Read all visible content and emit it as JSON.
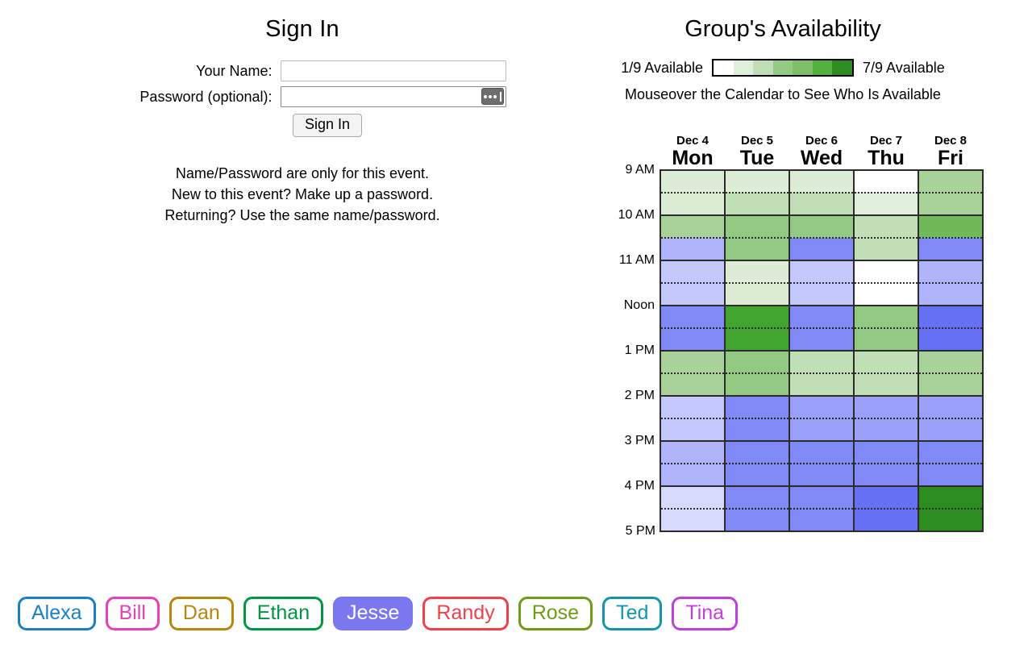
{
  "signin": {
    "title": "Sign In",
    "name_label": "Your Name:",
    "name_value": "",
    "name_placeholder": "",
    "password_label": "Password (optional):",
    "password_value": "",
    "password_placeholder": "",
    "password_manager_icon": "password-manager-icon",
    "button_label": "Sign In",
    "help_lines": [
      "Name/Password are only for this event.",
      "New to this event? Make up a password.",
      "Returning? Use the same name/password."
    ]
  },
  "availability": {
    "title": "Group's Availability",
    "legend_min_label": "1/9 Available",
    "legend_max_label": "7/9 Available",
    "legend_colors": [
      "#ffffff",
      "#e0efdb",
      "#c1dfb6",
      "#93c983",
      "#7ec06a",
      "#52b03f",
      "#2d8c20"
    ],
    "mouseover_hint": "Mouseover the Calendar to See Who Is Available"
  },
  "calendar": {
    "days": [
      {
        "date": "Dec 4",
        "dow": "Mon"
      },
      {
        "date": "Dec 5",
        "dow": "Tue"
      },
      {
        "date": "Dec 6",
        "dow": "Wed"
      },
      {
        "date": "Dec 7",
        "dow": "Thu"
      },
      {
        "date": "Dec 8",
        "dow": "Fri"
      }
    ],
    "time_labels": [
      "9 AM",
      "10 AM",
      "11 AM",
      "Noon",
      "1 PM",
      "2 PM",
      "3 PM",
      "4 PM",
      "5 PM"
    ],
    "slot_times": [
      "9:00",
      "9:30",
      "10:00",
      "10:30",
      "11:00",
      "11:30",
      "12:00",
      "12:30",
      "13:00",
      "13:30",
      "14:00",
      "14:30",
      "15:00",
      "15:30",
      "16:00",
      "16:30"
    ],
    "palette": {
      "green": [
        "#ffffff",
        "#e0efdb",
        "#c1dfb6",
        "#93c983",
        "#7ec06a",
        "#52b03f",
        "#2d8c20"
      ],
      "blue": [
        "#d6dafd",
        "#c3c9fc",
        "#b0b4fa",
        "#9aa0f8",
        "#8189f7",
        "#6670f5"
      ]
    },
    "cells": [
      {
        "day": "Mon",
        "slots": [
          {
            "time": "9:00",
            "fill": "#dcecd5",
            "kind": "green"
          },
          {
            "time": "9:30",
            "fill": "#dcecd5",
            "kind": "green"
          },
          {
            "time": "10:00",
            "fill": "#a9d29a",
            "kind": "green"
          },
          {
            "time": "10:30",
            "fill": "#b0b4fa",
            "kind": "blue"
          },
          {
            "time": "11:00",
            "fill": "#c3c9fc",
            "kind": "blue"
          },
          {
            "time": "11:30",
            "fill": "#c3c9fc",
            "kind": "blue"
          },
          {
            "time": "12:00",
            "fill": "#8189f7",
            "kind": "blue"
          },
          {
            "time": "12:30",
            "fill": "#8189f7",
            "kind": "blue"
          },
          {
            "time": "13:00",
            "fill": "#a9d29a",
            "kind": "green"
          },
          {
            "time": "13:30",
            "fill": "#a9d29a",
            "kind": "green"
          },
          {
            "time": "14:00",
            "fill": "#c3c9fc",
            "kind": "blue"
          },
          {
            "time": "14:30",
            "fill": "#c3c9fc",
            "kind": "blue"
          },
          {
            "time": "15:00",
            "fill": "#b0b4fa",
            "kind": "blue"
          },
          {
            "time": "15:30",
            "fill": "#b0b4fa",
            "kind": "blue"
          },
          {
            "time": "16:00",
            "fill": "#d6dafd",
            "kind": "blue"
          },
          {
            "time": "16:30",
            "fill": "#d6dafd",
            "kind": "blue"
          }
        ]
      },
      {
        "day": "Tue",
        "slots": [
          {
            "time": "9:00",
            "fill": "#dcecd5",
            "kind": "green"
          },
          {
            "time": "9:30",
            "fill": "#c1dfb6",
            "kind": "green"
          },
          {
            "time": "10:00",
            "fill": "#93c983",
            "kind": "green"
          },
          {
            "time": "10:30",
            "fill": "#93c983",
            "kind": "green"
          },
          {
            "time": "11:00",
            "fill": "#dcecd5",
            "kind": "green"
          },
          {
            "time": "11:30",
            "fill": "#dcecd5",
            "kind": "green"
          },
          {
            "time": "12:00",
            "fill": "#41a52f",
            "kind": "green"
          },
          {
            "time": "12:30",
            "fill": "#41a52f",
            "kind": "green"
          },
          {
            "time": "13:00",
            "fill": "#93c983",
            "kind": "green"
          },
          {
            "time": "13:30",
            "fill": "#93c983",
            "kind": "green"
          },
          {
            "time": "14:00",
            "fill": "#8189f7",
            "kind": "blue"
          },
          {
            "time": "14:30",
            "fill": "#8189f7",
            "kind": "blue"
          },
          {
            "time": "15:00",
            "fill": "#8189f7",
            "kind": "blue"
          },
          {
            "time": "15:30",
            "fill": "#8189f7",
            "kind": "blue"
          },
          {
            "time": "16:00",
            "fill": "#8189f7",
            "kind": "blue"
          },
          {
            "time": "16:30",
            "fill": "#8189f7",
            "kind": "blue"
          }
        ]
      },
      {
        "day": "Wed",
        "slots": [
          {
            "time": "9:00",
            "fill": "#dcecd5",
            "kind": "green"
          },
          {
            "time": "9:30",
            "fill": "#c1dfb6",
            "kind": "green"
          },
          {
            "time": "10:00",
            "fill": "#93c983",
            "kind": "green"
          },
          {
            "time": "10:30",
            "fill": "#8189f7",
            "kind": "blue"
          },
          {
            "time": "11:00",
            "fill": "#c3c9fc",
            "kind": "blue"
          },
          {
            "time": "11:30",
            "fill": "#c3c9fc",
            "kind": "blue"
          },
          {
            "time": "12:00",
            "fill": "#8189f7",
            "kind": "blue"
          },
          {
            "time": "12:30",
            "fill": "#8189f7",
            "kind": "blue"
          },
          {
            "time": "13:00",
            "fill": "#c1dfb6",
            "kind": "green"
          },
          {
            "time": "13:30",
            "fill": "#c1dfb6",
            "kind": "green"
          },
          {
            "time": "14:00",
            "fill": "#9aa0f8",
            "kind": "blue"
          },
          {
            "time": "14:30",
            "fill": "#9aa0f8",
            "kind": "blue"
          },
          {
            "time": "15:00",
            "fill": "#8189f7",
            "kind": "blue"
          },
          {
            "time": "15:30",
            "fill": "#8189f7",
            "kind": "blue"
          },
          {
            "time": "16:00",
            "fill": "#8189f7",
            "kind": "blue"
          },
          {
            "time": "16:30",
            "fill": "#8189f7",
            "kind": "blue"
          }
        ]
      },
      {
        "day": "Thu",
        "slots": [
          {
            "time": "9:00",
            "fill": "#ffffff",
            "kind": "green"
          },
          {
            "time": "9:30",
            "fill": "#e0efdb",
            "kind": "green"
          },
          {
            "time": "10:00",
            "fill": "#c1dfb6",
            "kind": "green"
          },
          {
            "time": "10:30",
            "fill": "#c1dfb6",
            "kind": "green"
          },
          {
            "time": "11:00",
            "fill": "#ffffff",
            "kind": "green"
          },
          {
            "time": "11:30",
            "fill": "#ffffff",
            "kind": "green"
          },
          {
            "time": "12:00",
            "fill": "#93c983",
            "kind": "green"
          },
          {
            "time": "12:30",
            "fill": "#93c983",
            "kind": "green"
          },
          {
            "time": "13:00",
            "fill": "#c1dfb6",
            "kind": "green"
          },
          {
            "time": "13:30",
            "fill": "#c1dfb6",
            "kind": "green"
          },
          {
            "time": "14:00",
            "fill": "#9aa0f8",
            "kind": "blue"
          },
          {
            "time": "14:30",
            "fill": "#9aa0f8",
            "kind": "blue"
          },
          {
            "time": "15:00",
            "fill": "#8189f7",
            "kind": "blue"
          },
          {
            "time": "15:30",
            "fill": "#8189f7",
            "kind": "blue"
          },
          {
            "time": "16:00",
            "fill": "#6670f5",
            "kind": "blue"
          },
          {
            "time": "16:30",
            "fill": "#6670f5",
            "kind": "blue"
          }
        ]
      },
      {
        "day": "Fri",
        "slots": [
          {
            "time": "9:00",
            "fill": "#a9d29a",
            "kind": "green"
          },
          {
            "time": "9:30",
            "fill": "#a9d29a",
            "kind": "green"
          },
          {
            "time": "10:00",
            "fill": "#6fb95a",
            "kind": "green"
          },
          {
            "time": "10:30",
            "fill": "#8189f7",
            "kind": "blue"
          },
          {
            "time": "11:00",
            "fill": "#b0b4fa",
            "kind": "blue"
          },
          {
            "time": "11:30",
            "fill": "#b0b4fa",
            "kind": "blue"
          },
          {
            "time": "12:00",
            "fill": "#6670f5",
            "kind": "blue"
          },
          {
            "time": "12:30",
            "fill": "#6670f5",
            "kind": "blue"
          },
          {
            "time": "13:00",
            "fill": "#a9d29a",
            "kind": "green"
          },
          {
            "time": "13:30",
            "fill": "#a9d29a",
            "kind": "green"
          },
          {
            "time": "14:00",
            "fill": "#9aa0f8",
            "kind": "blue"
          },
          {
            "time": "14:30",
            "fill": "#9aa0f8",
            "kind": "blue"
          },
          {
            "time": "15:00",
            "fill": "#8189f7",
            "kind": "blue"
          },
          {
            "time": "15:30",
            "fill": "#8189f7",
            "kind": "blue"
          },
          {
            "time": "16:00",
            "fill": "#2d8c20",
            "kind": "green"
          },
          {
            "time": "16:30",
            "fill": "#2d8c20",
            "kind": "green"
          }
        ]
      }
    ]
  },
  "people": [
    {
      "name": "Alexa",
      "color": "#1b7fc4",
      "selected": false
    },
    {
      "name": "Bill",
      "color": "#e83fb5",
      "selected": false
    },
    {
      "name": "Dan",
      "color": "#b8860b",
      "selected": false
    },
    {
      "name": "Ethan",
      "color": "#009644",
      "selected": false
    },
    {
      "name": "Jesse",
      "color": "#7b78ef",
      "selected": true
    },
    {
      "name": "Randy",
      "color": "#f0414b",
      "selected": false
    },
    {
      "name": "Rose",
      "color": "#6d9c18",
      "selected": false
    },
    {
      "name": "Ted",
      "color": "#1296a8",
      "selected": false
    },
    {
      "name": "Tina",
      "color": "#c040dd",
      "selected": false
    }
  ]
}
